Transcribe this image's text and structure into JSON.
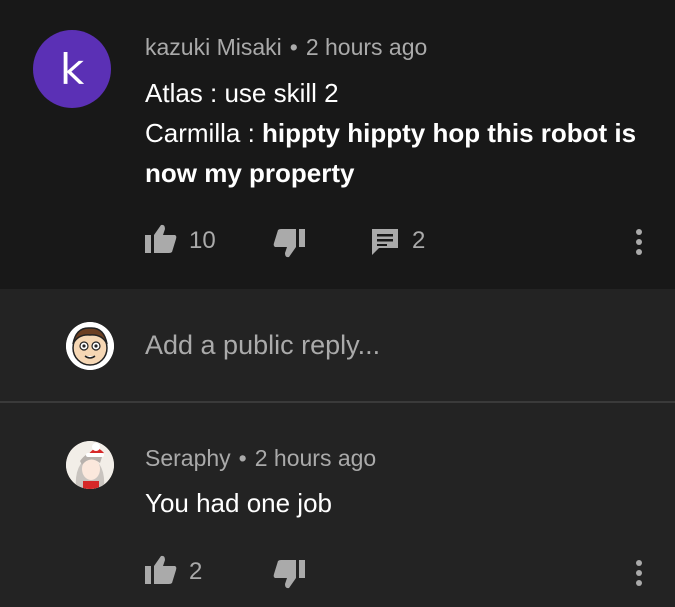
{
  "comment": {
    "avatar_letter": "k",
    "author": "kazuki Misaki",
    "time": "2 hours ago",
    "line1": "Atlas : use skill 2",
    "line2_speaker": "Carmilla : ",
    "line2_text": "hippty hippty hop this robot is",
    "line3_text": "now my property",
    "likes": "10",
    "replies": "2"
  },
  "reply_box": {
    "placeholder": "Add a public reply..."
  },
  "reply": {
    "author": "Seraphy",
    "time": "2 hours ago",
    "text": "You had one job",
    "likes": "2"
  },
  "colors": {
    "top_bg": "#181818",
    "bg": "#232323",
    "avatar_purple": "#5b30b5",
    "meta_gray": "#aaaaaa"
  }
}
